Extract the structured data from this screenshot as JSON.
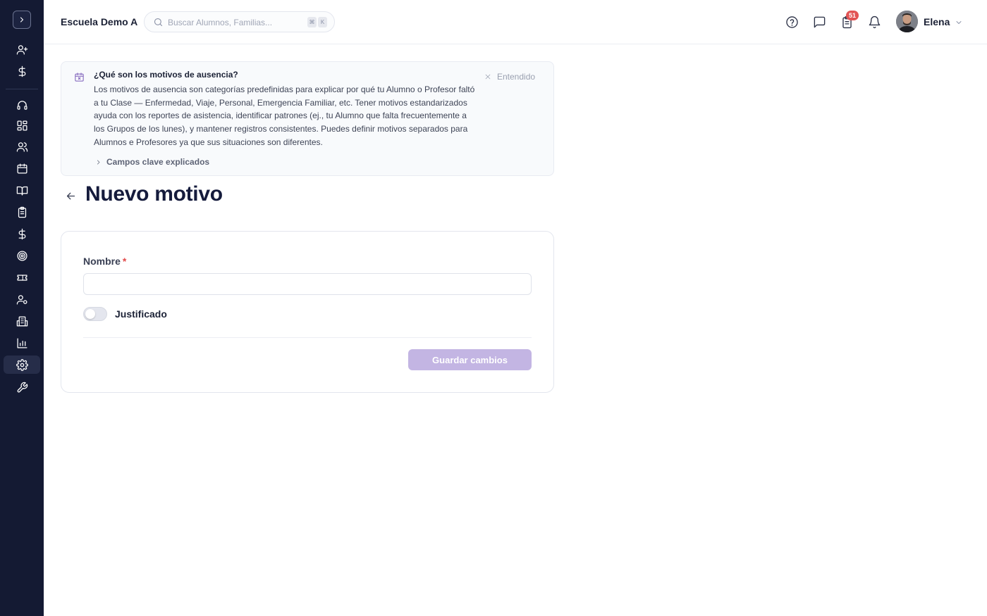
{
  "header": {
    "school_name": "Escuela Demo A",
    "search_placeholder": "Buscar Alumnos, Familias...",
    "shortcut_keys": [
      "⌘",
      "K"
    ],
    "tasks_badge": "51",
    "user_name": "Elena"
  },
  "sidebar": {
    "items": [
      {
        "icon": "user-plus-icon"
      },
      {
        "icon": "dollar-icon"
      },
      {
        "icon": "headset-icon"
      },
      {
        "icon": "dashboard-icon"
      },
      {
        "icon": "users-icon"
      },
      {
        "icon": "calendar-icon"
      },
      {
        "icon": "book-icon"
      },
      {
        "icon": "clipboard-icon"
      },
      {
        "icon": "dollar-icon"
      },
      {
        "icon": "target-icon"
      },
      {
        "icon": "ticket-icon"
      },
      {
        "icon": "user-settings-icon"
      },
      {
        "icon": "building-icon"
      },
      {
        "icon": "bar-chart-icon"
      },
      {
        "icon": "settings-icon"
      },
      {
        "icon": "wrench-icon"
      }
    ],
    "active_item": "settings-icon"
  },
  "banner": {
    "title": "¿Qué son los motivos de ausencia?",
    "text": "Los motivos de ausencia son categorías predefinidas para explicar por qué tu Alumno o Profesor faltó a tu Clase — Enfermedad, Viaje, Personal, Emergencia Familiar, etc. Tener motivos estandarizados ayuda con los reportes de asistencia, identificar patrones (ej., tu Alumno que falta frecuentemente a los Grupos de los lunes), y mantener registros consistentes. Puedes definir motivos separados para Alumnos e Profesores ya que sus situaciones son diferentes.",
    "dismiss_label": "Entendido",
    "expander_label": "Campos clave explicados"
  },
  "page": {
    "title": "Nuevo motivo"
  },
  "form": {
    "name_label": "Nombre",
    "required_mark": "*",
    "name_value": "",
    "justified_label": "Justificado",
    "justified_on": false,
    "save_label": "Guardar cambios"
  },
  "colors": {
    "sidebar_bg": "#141a33",
    "accent_disabled": "#c3b5e3",
    "title": "#151b3c",
    "badge": "#e25555"
  }
}
